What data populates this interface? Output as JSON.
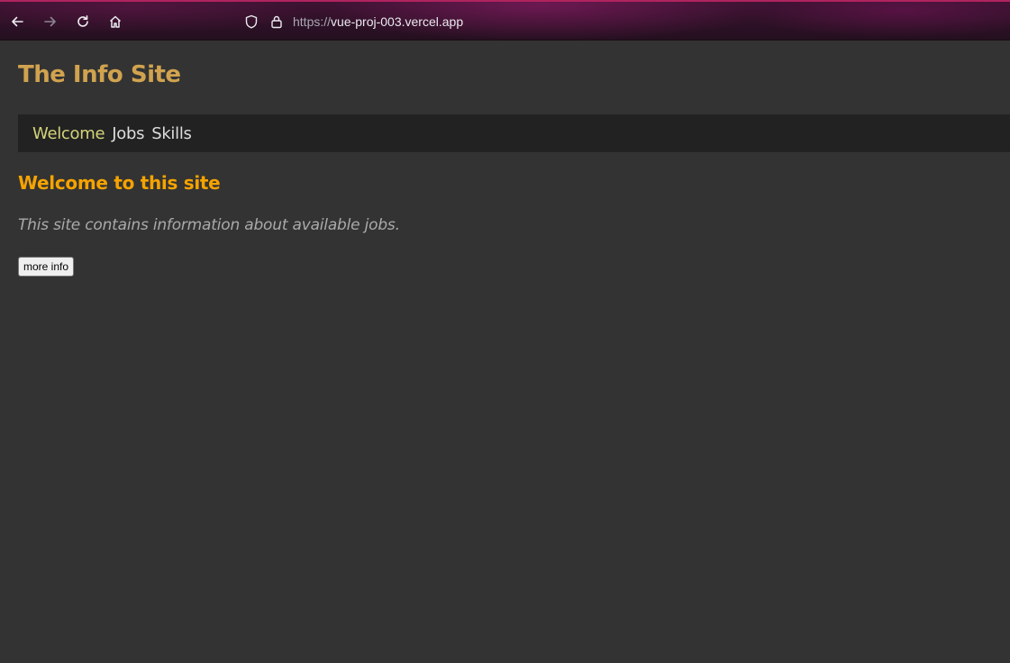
{
  "browser": {
    "url_scheme": "https://",
    "url_host": "vue-proj-003.vercel.app",
    "icons": [
      "back-arrow-icon",
      "forward-arrow-icon",
      "reload-icon",
      "home-icon",
      "shield-icon",
      "lock-icon"
    ],
    "accent_color": "#b0245e"
  },
  "site": {
    "title": "The Info Site",
    "title_color": "#d1a34f"
  },
  "nav": {
    "items": [
      {
        "label": "Welcome",
        "active": true
      },
      {
        "label": "Jobs",
        "active": false
      },
      {
        "label": "Skills",
        "active": false
      }
    ],
    "active_color": "#d3d37a"
  },
  "main": {
    "heading": "Welcome to this site",
    "heading_color": "#f5a300",
    "description": "This site contains information about available jobs.",
    "button_label": "more info"
  }
}
